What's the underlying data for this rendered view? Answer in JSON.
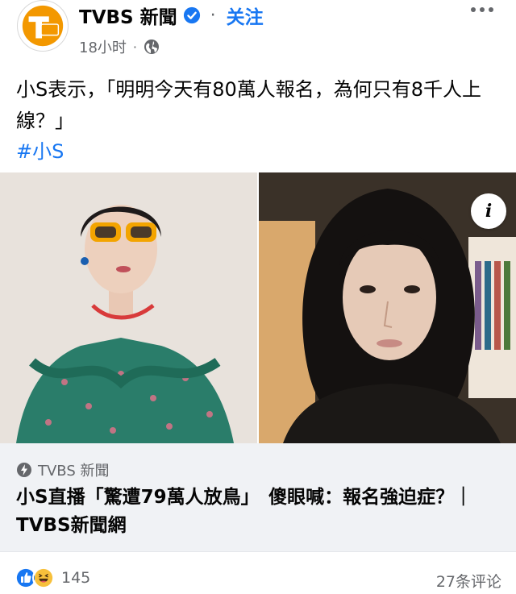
{
  "header": {
    "page_name": "TVBS 新聞",
    "separator": "·",
    "follow_label": "关注",
    "timestamp": "18小时",
    "meta_separator": "·",
    "avatar_text": "TVBS新聞",
    "brand_color": "#f39800",
    "accent_color": "#1877f2",
    "icons": [
      "verified-badge-icon",
      "globe-icon",
      "more-options-icon"
    ]
  },
  "post": {
    "text": "小S表示，「明明今天有80萬人報名，為何只有8千人上線？」",
    "hashtag": "#小S"
  },
  "photos": {
    "info_label": "i"
  },
  "link_preview": {
    "source": "TVBS 新聞",
    "title": "小S直播「驚遭79萬人放鳥」　傻眼喊：報名強迫症？｜TVBS新聞網",
    "source_icon": "lightning-bolt-icon"
  },
  "footer": {
    "reaction_count": "145",
    "comment_count": "27条评论",
    "reaction_icons": [
      "like-icon",
      "haha-icon"
    ]
  }
}
